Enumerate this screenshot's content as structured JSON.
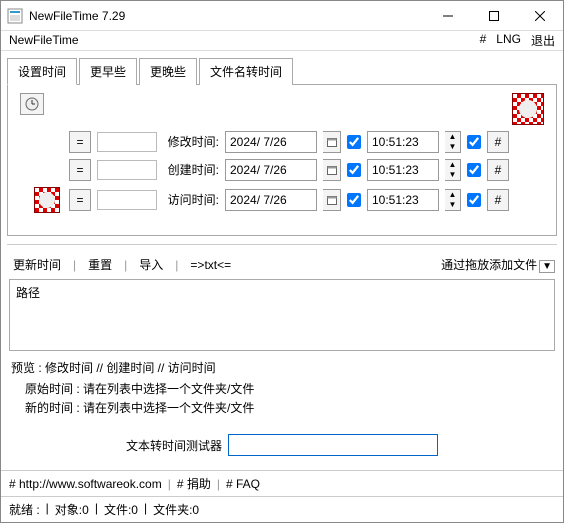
{
  "window": {
    "title": "NewFileTime 7.29"
  },
  "menubar": {
    "app": "NewFileTime",
    "hash": "#",
    "lng": "LNG",
    "exit": "退出"
  },
  "tabs": [
    "设置时间",
    "更早些",
    "更晚些",
    "文件名转时间"
  ],
  "rows": {
    "labels": {
      "modify": "修改时间:",
      "create": "创建时间:",
      "access": "访问时间:"
    },
    "eq": "=",
    "date": "2024/ 7/26",
    "time": "10:51:23",
    "hash": "#"
  },
  "toolbar2": {
    "update": "更新时间",
    "reset": "重置",
    "import": "导入",
    "txt": "=>txt<=",
    "drop": "通过拖放添加文件"
  },
  "filelist": {
    "header": "路径"
  },
  "preview": {
    "header": "预览 :   修改时间   //   创建时间   //   访问时间",
    "orig": "原始时间 : 请在列表中选择一个文件夹/文件",
    "new": "新的时间 : 请在列表中选择一个文件夹/文件"
  },
  "tester": {
    "label": "文本转时间测试器"
  },
  "footer": {
    "url": "# http://www.softwareok.com",
    "donate": "# 捐助",
    "faq": "# FAQ"
  },
  "status": {
    "ready": "就绪 :",
    "objs": "对象:0",
    "files": "文件:0",
    "folders": "文件夹:0"
  }
}
